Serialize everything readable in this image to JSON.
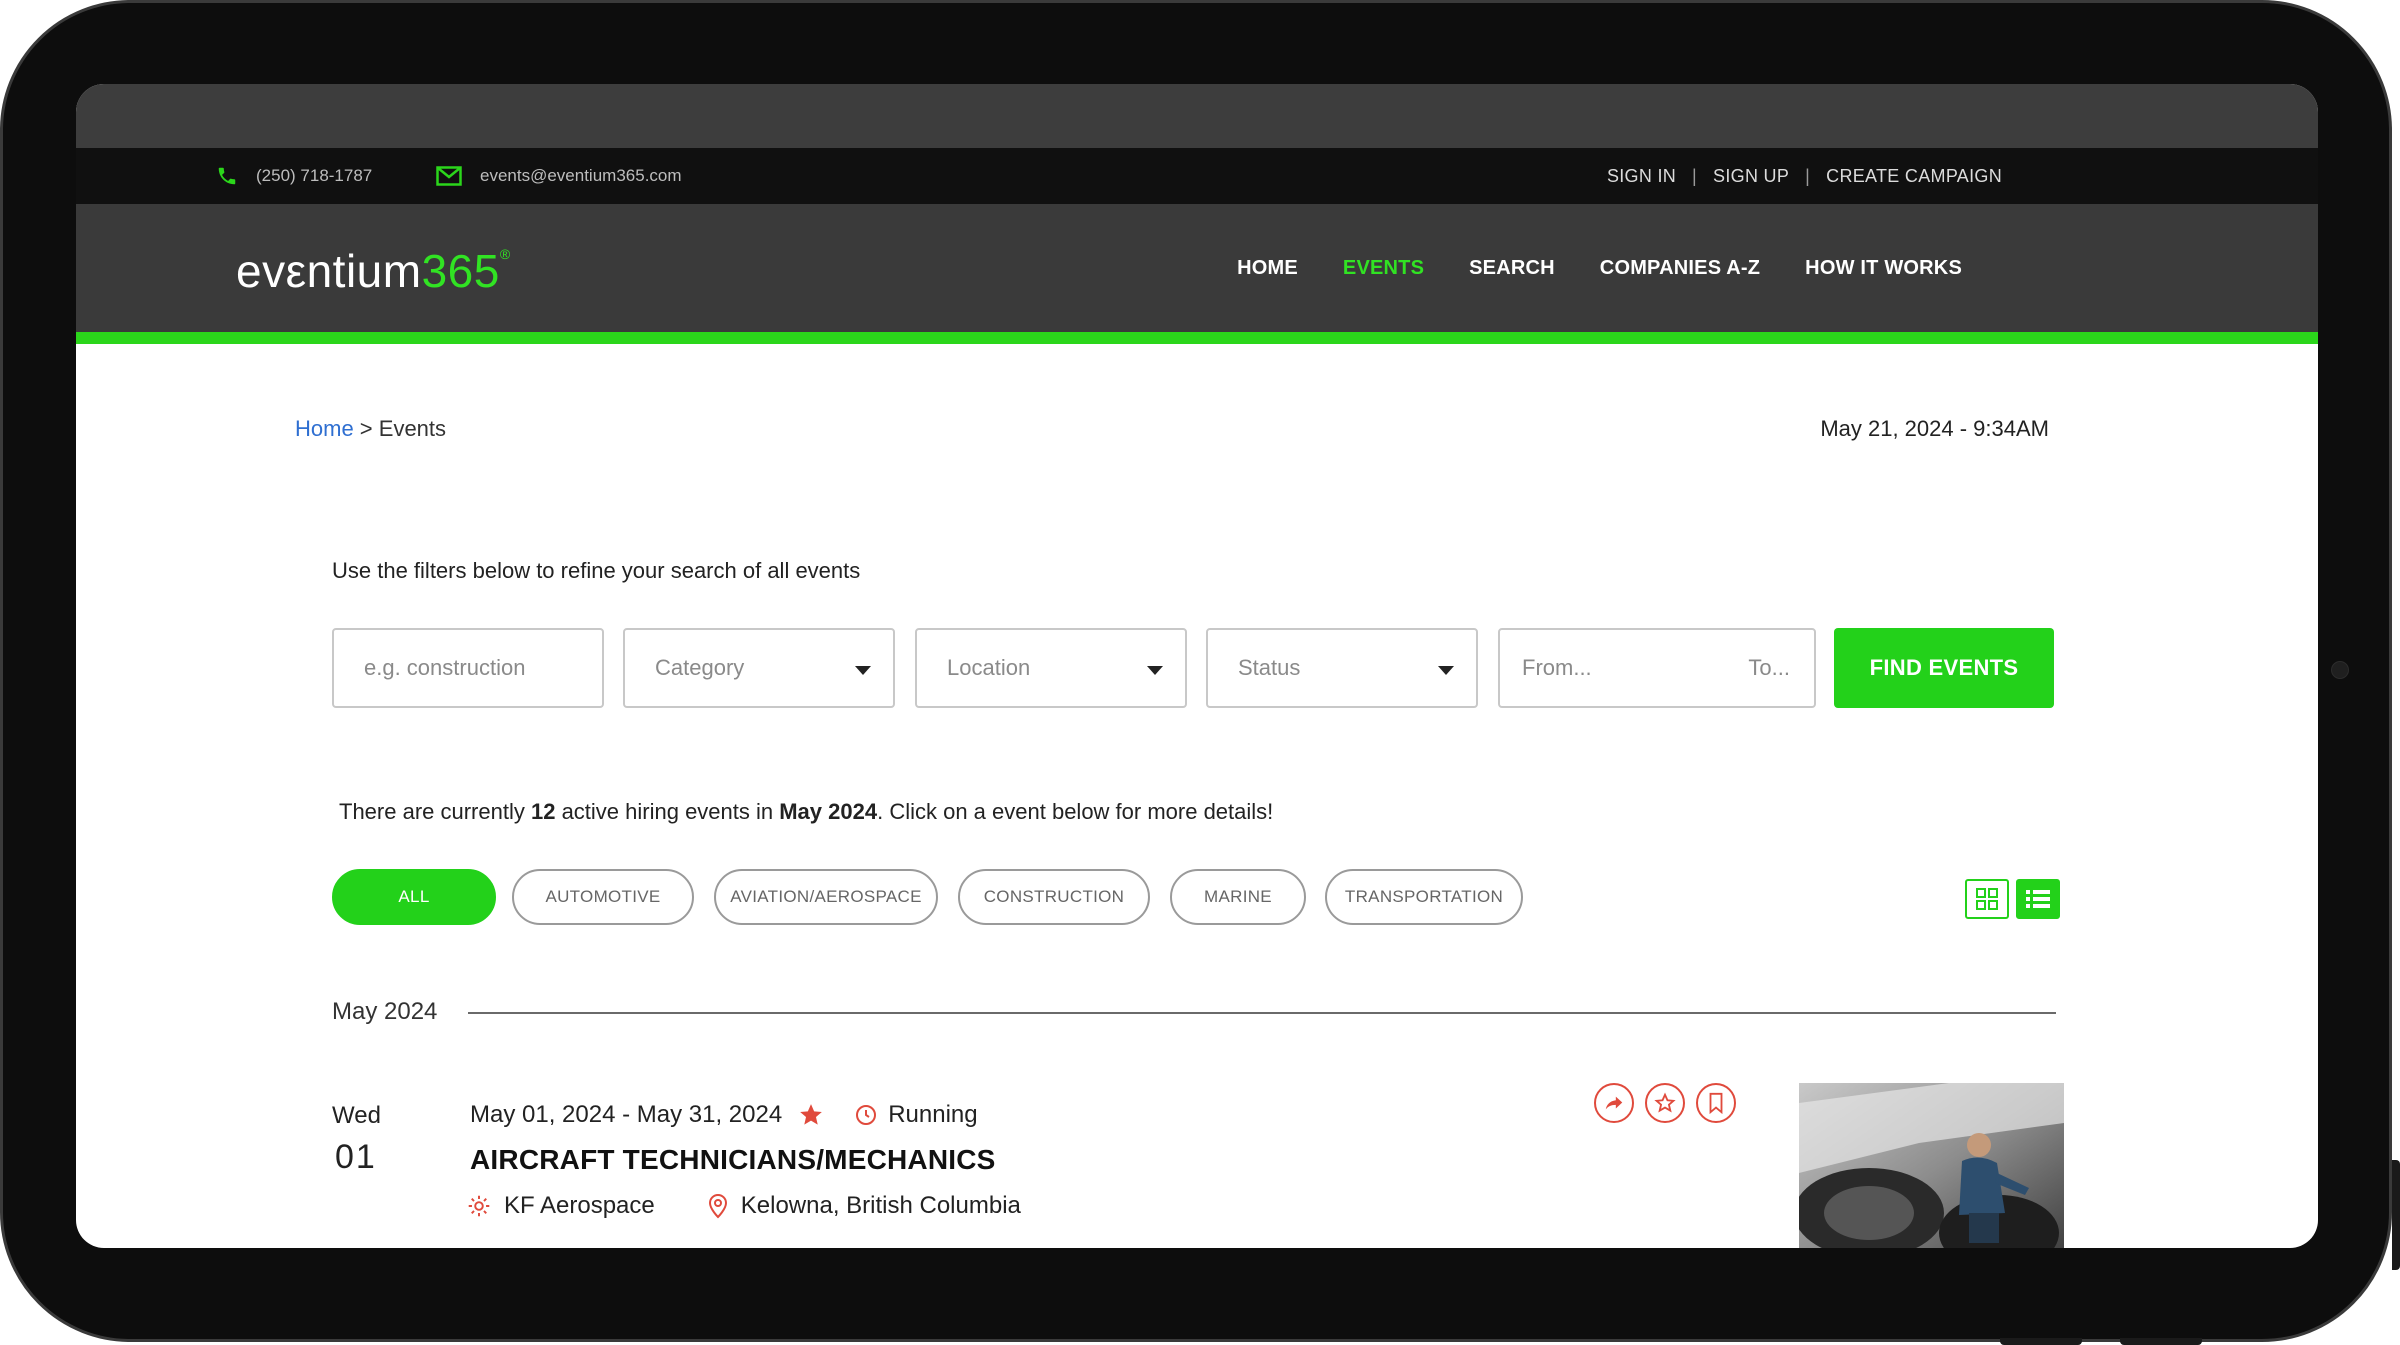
{
  "topbar": {
    "phone": "(250) 718-1787",
    "email": "events@eventium365.com",
    "sign_in": "SIGN IN",
    "sign_up": "SIGN UP",
    "create_campaign": "CREATE CAMPAIGN",
    "separator": "|"
  },
  "header": {
    "logo_text": "evεntium",
    "logo_number": "365",
    "logo_mark": "®",
    "nav": {
      "home": "HOME",
      "events": "EVENTS",
      "search": "SEARCH",
      "companies": "COMPANIES A-Z",
      "how": "HOW IT WORKS"
    }
  },
  "breadcrumb": {
    "home": "Home",
    "sep": " > ",
    "current": "Events"
  },
  "datetime": "May 21, 2024 - 9:34AM",
  "filters": {
    "intro": "Use the filters below to refine your search of all events",
    "keyword_placeholder": "e.g. construction",
    "category": "Category",
    "location": "Location",
    "status": "Status",
    "from": "From...",
    "to": "To...",
    "find_button": "FIND EVENTS"
  },
  "summary": {
    "pre": "There are currently ",
    "count": "12",
    "mid": " active hiring events in ",
    "month": "May 2024",
    "post": ". Click on a event below for more details!"
  },
  "categories": {
    "all": "ALL",
    "automotive": "AUTOMOTIVE",
    "aviation": "AVIATION/AEROSPACE",
    "construction": "CONSTRUCTION",
    "marine": "MARINE",
    "transportation": "TRANSPORTATION"
  },
  "month_heading": "May 2024",
  "event": {
    "weekday": "Wed",
    "day": "01",
    "range": "May 01, 2024 - May 31, 2024",
    "status": "Running",
    "title": "AIRCRAFT TECHNICIANS/MECHANICS",
    "company": "KF Aerospace",
    "location": "Kelowna, British Columbia"
  },
  "colors": {
    "brand_green": "#23d11a",
    "nav_bg": "#3a3a3a",
    "topbar_bg": "#101010",
    "accent_red": "#e04a3c",
    "link_blue": "#2f6fd1"
  },
  "icons": {
    "phone": "phone-icon",
    "email": "mail-icon",
    "share": "share-icon",
    "favorite": "star-icon",
    "bookmark": "bookmark-icon",
    "clock": "clock-icon",
    "company": "gear-icon",
    "location": "map-pin-icon",
    "grid_view": "grid-view-icon",
    "list_view": "list-view-icon"
  }
}
